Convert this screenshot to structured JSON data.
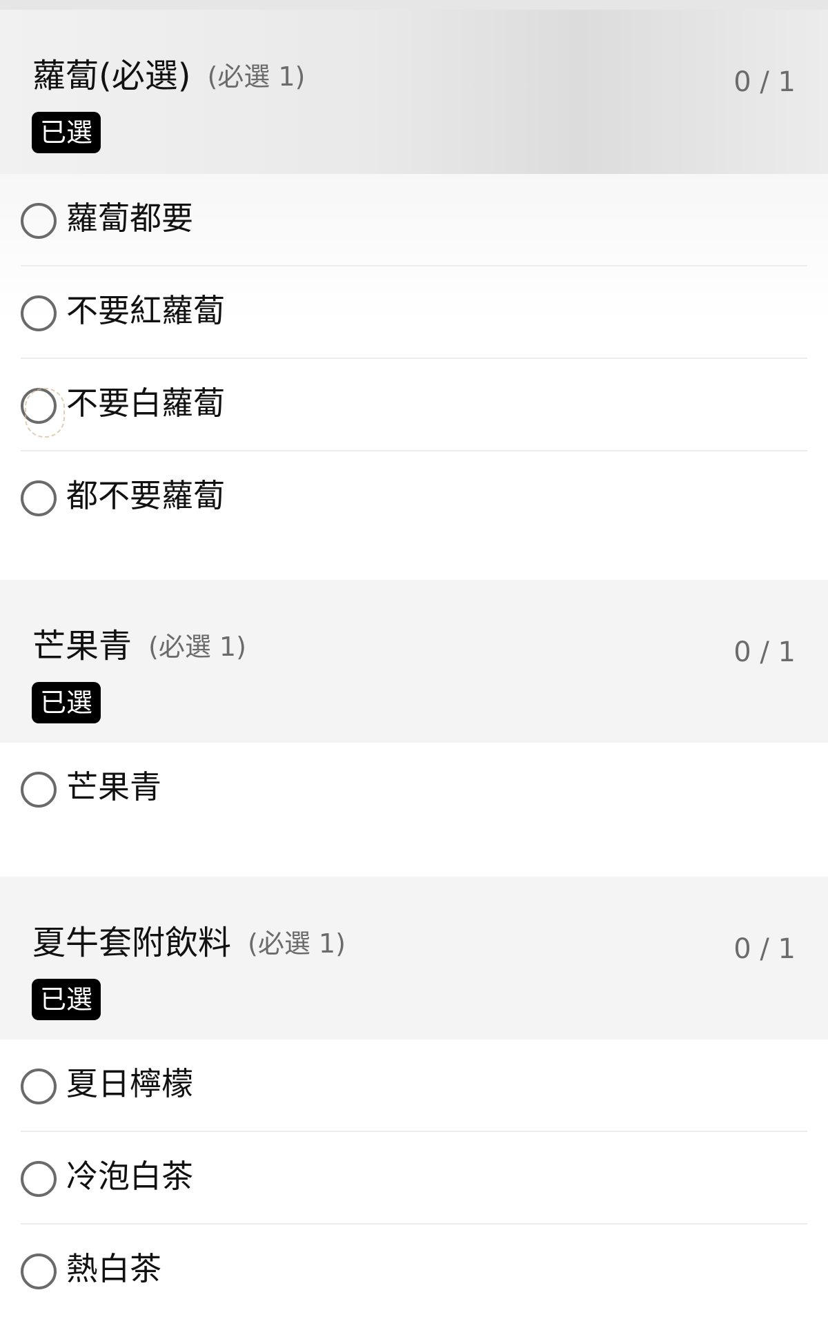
{
  "groups": [
    {
      "name": "蘿蔔(必選)",
      "requirement": "(必選 1)",
      "count": "0 / 1",
      "badge": "已選",
      "options": [
        {
          "label": "蘿蔔都要"
        },
        {
          "label": "不要紅蘿蔔"
        },
        {
          "label": "不要白蘿蔔"
        },
        {
          "label": "都不要蘿蔔"
        }
      ]
    },
    {
      "name": "芒果青",
      "requirement": "(必選 1)",
      "count": "0 / 1",
      "badge": "已選",
      "options": [
        {
          "label": "芒果青"
        }
      ]
    },
    {
      "name": "夏牛套附飲料",
      "requirement": "(必選 1)",
      "count": "0 / 1",
      "badge": "已選",
      "options": [
        {
          "label": "夏日檸檬"
        },
        {
          "label": "冷泡白茶"
        },
        {
          "label": "熱白茶"
        }
      ]
    }
  ]
}
